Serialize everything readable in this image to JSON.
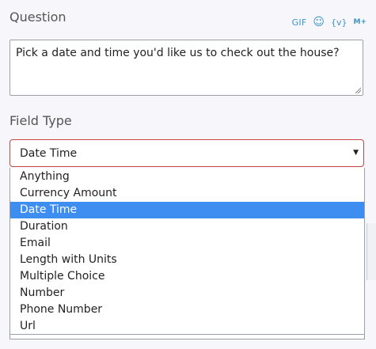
{
  "question": {
    "label": "Question",
    "value": "Pick a date and time you'd like us to check out the house?",
    "tools": {
      "gif": "GIF",
      "emoji_icon": "smiley-icon",
      "variable": "{v}",
      "markdown": "M+"
    }
  },
  "field_type": {
    "label": "Field Type",
    "selected": "Date Time",
    "options": [
      "Anything",
      "Currency Amount",
      "Date Time",
      "Duration",
      "Email",
      "Length with Units",
      "Multiple Choice",
      "Number",
      "Phone Number",
      "Url"
    ],
    "selected_index": 2
  },
  "colors": {
    "accent": "#3a93c9",
    "selected_bg": "#3d8ef0",
    "invalid_border": "#c84545"
  }
}
